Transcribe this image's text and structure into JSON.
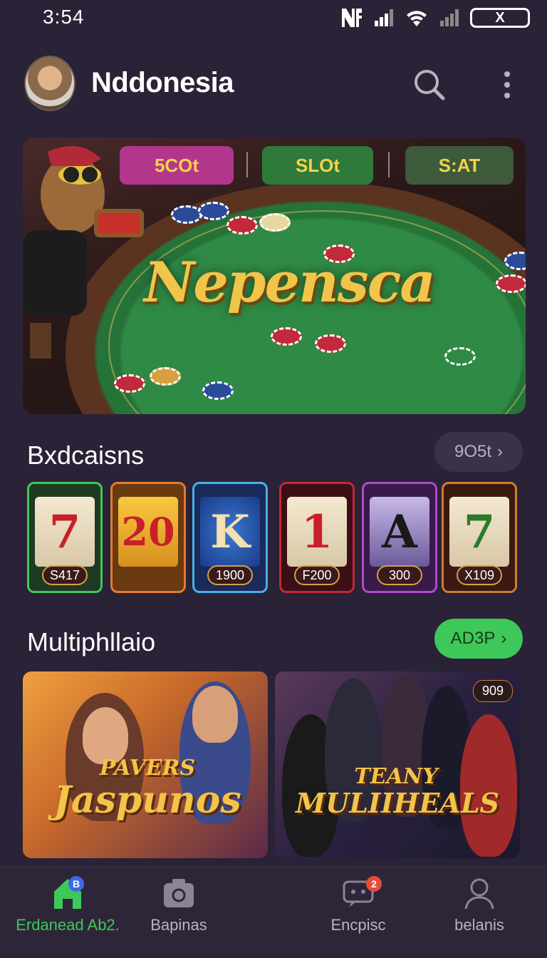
{
  "status_bar": {
    "time": "3:54",
    "battery": "X"
  },
  "header": {
    "title": "Nddonesia",
    "search_icon": "search-icon",
    "more_icon": "more-vertical-icon"
  },
  "hero": {
    "tabs": [
      "5COt",
      "SLOt",
      "S:AT"
    ],
    "logo_text": "Nepensca"
  },
  "slots_section": {
    "title": "Bxdcaisns",
    "button": "9O5t",
    "cards": [
      {
        "symbol": "7",
        "value": "S417",
        "border": "#3ec85a"
      },
      {
        "symbol": "20",
        "value": "",
        "border": "#e87a30"
      },
      {
        "symbol": "K",
        "value": "1900",
        "border": "#4ab0e8"
      },
      {
        "symbol": "1",
        "value": "F200",
        "border": "#c02a3a"
      },
      {
        "symbol": "A",
        "value": "300",
        "border": "#b04ad0"
      },
      {
        "symbol": "7",
        "value": "X109",
        "border": "#d47a30"
      }
    ]
  },
  "multi_section": {
    "title": "Multiphllaio",
    "button": "AD3P",
    "cards": [
      {
        "line1": "PAVERS",
        "line2": "Jaspunos"
      },
      {
        "line1": "TEANY",
        "line2": "MULIIHEALS",
        "badge": "909"
      }
    ]
  },
  "bottom_nav": {
    "items": [
      {
        "label": "Erdanead Ab2.",
        "icon": "home-icon",
        "badge": "B",
        "active": true
      },
      {
        "label": "Bapinas",
        "icon": "camera-icon",
        "active": false
      },
      {
        "label": "Encpisc",
        "icon": "chat-icon",
        "badge": "2",
        "active": false
      },
      {
        "label": "belanis",
        "icon": "profile-icon",
        "active": false
      }
    ]
  },
  "colors": {
    "background": "#2a2236",
    "accent_green": "#3ec85a",
    "nav_bg": "#2e2638"
  }
}
